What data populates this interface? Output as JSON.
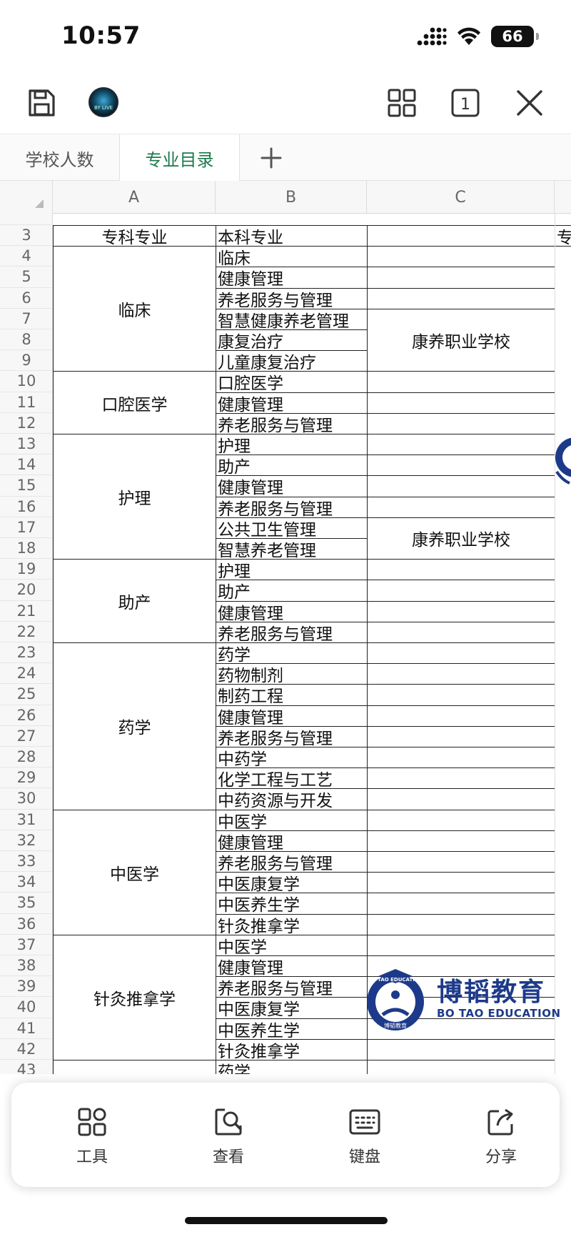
{
  "status_bar": {
    "time": "10:57",
    "battery": "66"
  },
  "tabs": [
    {
      "label": "学校人数",
      "active": false
    },
    {
      "label": "专业目录",
      "active": true
    }
  ],
  "toolbar": {
    "window_count": "1"
  },
  "columns": [
    "A",
    "B",
    "C"
  ],
  "rows": [
    "3",
    "4",
    "5",
    "6",
    "7",
    "8",
    "9",
    "10",
    "11",
    "12",
    "13",
    "14",
    "15",
    "16",
    "17",
    "18",
    "19",
    "20",
    "21",
    "22",
    "23",
    "24",
    "25",
    "26",
    "27",
    "28",
    "29",
    "30",
    "31",
    "32",
    "33",
    "34",
    "35",
    "36",
    "37",
    "38",
    "39",
    "40",
    "41",
    "42",
    "43"
  ],
  "sheet": {
    "header": {
      "a": "专科专业",
      "b": "本科专业",
      "d_partial": "专"
    },
    "groups": [
      {
        "name": "临床",
        "majors": [
          "临床",
          "健康管理",
          "养老服务与管理",
          "智慧健康养老管理",
          "康复治疗",
          "儿童康复治疗"
        ]
      },
      {
        "name": "口腔医学",
        "majors": [
          "口腔医学",
          "健康管理",
          "养老服务与管理"
        ]
      },
      {
        "name": "护理",
        "majors": [
          "护理",
          "助产",
          "健康管理",
          "养老服务与管理",
          "公共卫生管理",
          "智慧养老管理"
        ]
      },
      {
        "name": "助产",
        "majors": [
          "护理",
          "助产",
          "健康管理",
          "养老服务与管理"
        ]
      },
      {
        "name": "药学",
        "majors": [
          "药学",
          "药物制剂",
          "制药工程",
          "健康管理",
          "养老服务与管理",
          "中药学",
          "化学工程与工艺",
          "中药资源与开发"
        ]
      },
      {
        "name": "中医学",
        "majors": [
          "中医学",
          "健康管理",
          "养老服务与管理",
          "中医康复学",
          "中医养生学",
          "针灸推拿学"
        ]
      },
      {
        "name": "针灸推拿学",
        "majors": [
          "中医学",
          "健康管理",
          "养老服务与管理",
          "中医康复学",
          "中医养生学",
          "针灸推拿学"
        ]
      }
    ],
    "last_partial": "药学",
    "schools": [
      "康养职业学校",
      "康养职业学校"
    ]
  },
  "watermark": {
    "cn": "博韬教育",
    "en": "BO TAO EDUCATION",
    "ring": "BO TAO EDUCATION",
    "seal": "博韬教育"
  },
  "avatar_text": "BY LIVE",
  "bottom_bar": [
    {
      "label": "工具",
      "icon": "tools-grid-icon"
    },
    {
      "label": "查看",
      "icon": "view-search-icon"
    },
    {
      "label": "键盘",
      "icon": "keyboard-icon"
    },
    {
      "label": "分享",
      "icon": "share-icon"
    }
  ]
}
